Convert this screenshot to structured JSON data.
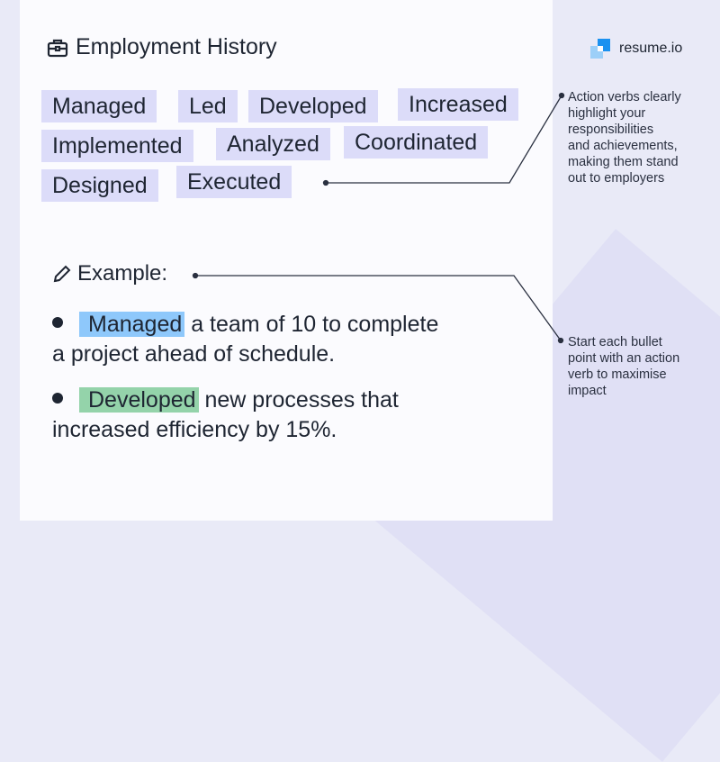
{
  "section": {
    "title": "Employment History",
    "icon": "briefcase-icon"
  },
  "brand": {
    "name": "resume.io",
    "colors": {
      "primary": "#1a91f0",
      "light": "#9ccff8"
    }
  },
  "action_verbs": [
    "Managed",
    "Led",
    "Developed",
    "Increased",
    "Implemented",
    "Analyzed",
    "Coordinated",
    "Designed",
    "Executed"
  ],
  "notes": {
    "verbs_note": [
      "Action verbs clearly",
      "highlight your",
      "responsibilities",
      "and achievements,",
      "making them stand",
      "out to employers"
    ],
    "bullet_note": [
      "Start each bullet",
      "point with an action",
      "verb to maximise",
      "impact"
    ]
  },
  "example": {
    "label": "Example:",
    "icon": "pencil-icon",
    "bullets": [
      {
        "verb": "Managed",
        "line1": "a team of 10 to complete",
        "line2": "a project ahead of schedule.",
        "highlight": "#8ec8fb"
      },
      {
        "verb": "Developed",
        "line1": "new processes that",
        "line2": "increased efficiency by 15%.",
        "highlight": "#94d3aa"
      }
    ]
  },
  "colors": {
    "tag_bg": "#dcdcf9",
    "text": "#1e2532",
    "background": "#e9eaf7"
  }
}
